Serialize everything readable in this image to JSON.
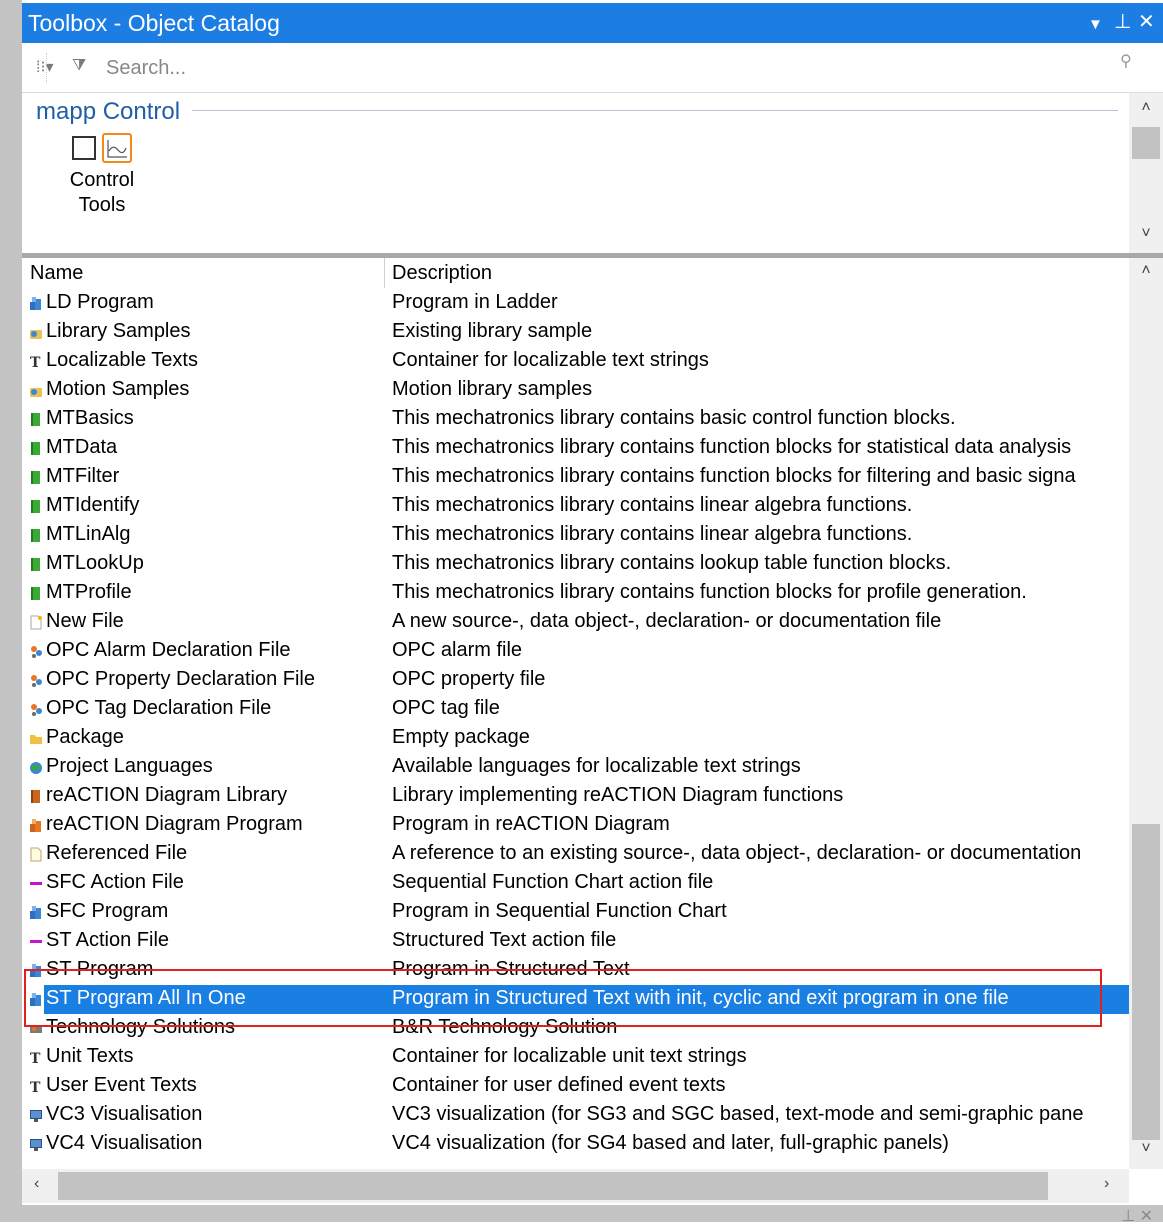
{
  "window": {
    "title": "Toolbox - Object Catalog",
    "buttons": {
      "dropdown": "▼",
      "pin": "⊥",
      "close": "✕"
    }
  },
  "toolbar": {
    "view_icon": "⁞⁝▾",
    "filter_icon": "⧩",
    "search_placeholder": "Search...",
    "search_value": ""
  },
  "catalog": {
    "section_title": "mapp Control",
    "item_label": "Control Tools"
  },
  "list": {
    "columns": {
      "name": "Name",
      "description": "Description"
    },
    "selected_index": 24,
    "rows": [
      {
        "name": "LD Program",
        "description": "Program in Ladder",
        "icon": "program-icon"
      },
      {
        "name": "Library Samples",
        "description": "Existing library sample",
        "icon": "sample-icon"
      },
      {
        "name": "Localizable Texts",
        "description": "Container for localizable text strings",
        "icon": "text-icon"
      },
      {
        "name": "Motion Samples",
        "description": "Motion library samples",
        "icon": "sample-icon"
      },
      {
        "name": "MTBasics",
        "description": "This mechatronics library contains basic control function blocks.",
        "icon": "library-icon"
      },
      {
        "name": "MTData",
        "description": "This mechatronics library contains function blocks for statistical data analysis",
        "icon": "library-icon"
      },
      {
        "name": "MTFilter",
        "description": "This mechatronics library contains function blocks for filtering and basic signa",
        "icon": "library-icon"
      },
      {
        "name": "MTIdentify",
        "description": "This mechatronics library contains linear algebra functions.",
        "icon": "library-icon"
      },
      {
        "name": "MTLinAlg",
        "description": "This mechatronics library contains linear algebra functions.",
        "icon": "library-icon"
      },
      {
        "name": "MTLookUp",
        "description": "This mechatronics library contains lookup table function blocks.",
        "icon": "library-icon"
      },
      {
        "name": "MTProfile",
        "description": "This mechatronics library contains function blocks for profile generation.",
        "icon": "library-icon"
      },
      {
        "name": "New File",
        "description": "A new source-, data object-, declaration- or documentation file",
        "icon": "new-file-icon"
      },
      {
        "name": "OPC Alarm Declaration File",
        "description": "OPC alarm file",
        "icon": "opc-icon"
      },
      {
        "name": "OPC Property Declaration File",
        "description": "OPC property file",
        "icon": "opc-icon"
      },
      {
        "name": "OPC Tag Declaration File",
        "description": "OPC tag file",
        "icon": "opc-icon"
      },
      {
        "name": "Package",
        "description": "Empty package",
        "icon": "package-icon"
      },
      {
        "name": "Project Languages",
        "description": "Available languages for localizable text strings",
        "icon": "globe-icon"
      },
      {
        "name": "reACTION Diagram Library",
        "description": "Library implementing reACTION Diagram functions",
        "icon": "reaction-library-icon"
      },
      {
        "name": "reACTION Diagram Program",
        "description": "Program in reACTION Diagram",
        "icon": "reaction-program-icon"
      },
      {
        "name": "Referenced File",
        "description": "A reference to an existing source-, data object-, declaration- or documentation",
        "icon": "referenced-file-icon"
      },
      {
        "name": "SFC Action File",
        "description": "Sequential Function Chart action file",
        "icon": "action-file-icon"
      },
      {
        "name": "SFC Program",
        "description": "Program in Sequential Function Chart",
        "icon": "program-icon"
      },
      {
        "name": "ST Action File",
        "description": "Structured Text action file",
        "icon": "action-file-icon"
      },
      {
        "name": "ST Program",
        "description": "Program in Structured Text",
        "icon": "program-icon"
      },
      {
        "name": "ST Program All In One",
        "description": "Program in Structured Text with init, cyclic and exit program in one file",
        "icon": "program-icon"
      },
      {
        "name": "Technology Solutions",
        "description": "B&R Technology Solution",
        "icon": "technology-icon"
      },
      {
        "name": "Unit Texts",
        "description": "Container for localizable unit text strings",
        "icon": "text-icon"
      },
      {
        "name": "User Event Texts",
        "description": "Container for user defined event texts",
        "icon": "text-icon"
      },
      {
        "name": "VC3 Visualisation",
        "description": "VC3 visualization (for SG3 and SGC based, text-mode and semi-graphic pane",
        "icon": "monitor-icon"
      },
      {
        "name": "VC4 Visualisation",
        "description": "VC4 visualization (for SG4 based and later, full-graphic panels)",
        "icon": "monitor-icon"
      }
    ]
  },
  "scroll": {
    "catalog_position": 0.0,
    "list_position": 1.0,
    "horizontal_position": 0.0
  },
  "colors": {
    "title_bar": "#1c7ee3",
    "selection": "#1a7fe2",
    "highlight_box": "#e1201f",
    "section_title": "#1f5fa8",
    "control_tools_border": "#f08a1c"
  }
}
